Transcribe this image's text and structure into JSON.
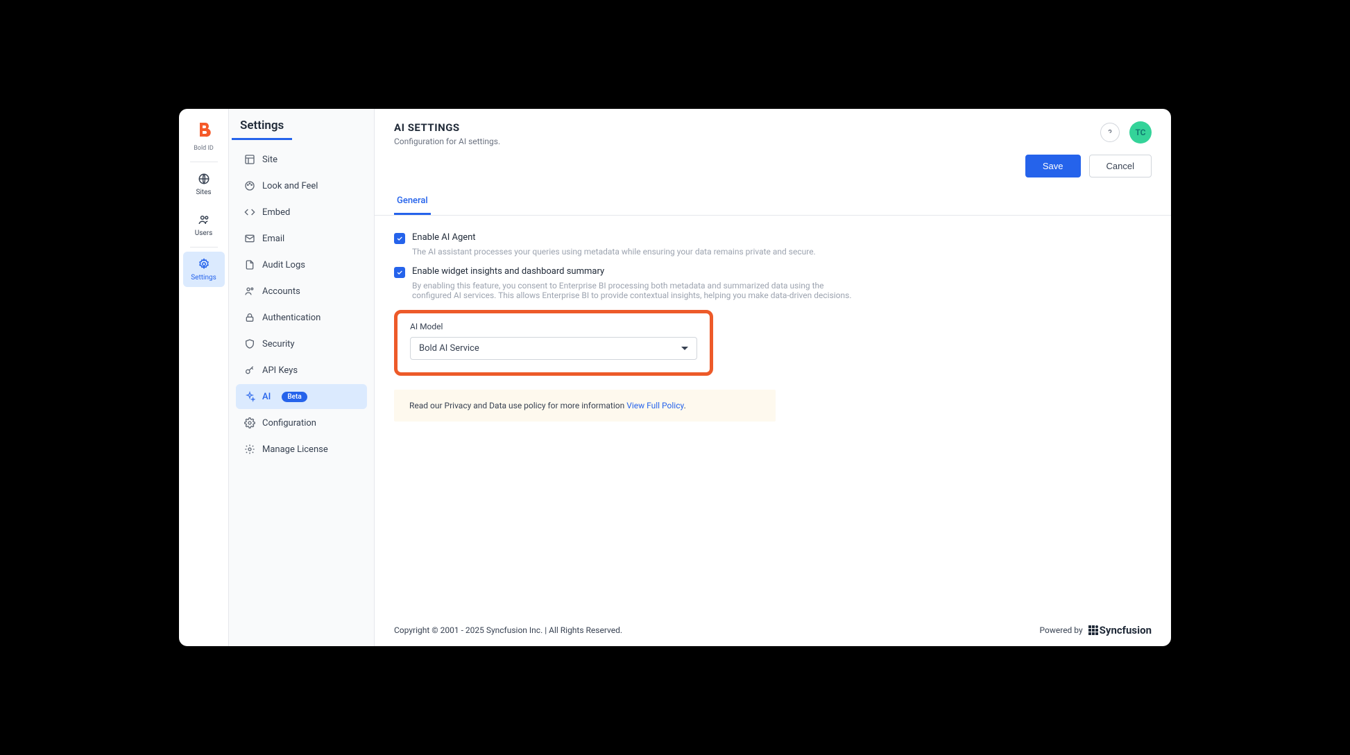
{
  "rail": {
    "logo_text": "Bold ID",
    "items": [
      {
        "id": "sites",
        "label": "Sites"
      },
      {
        "id": "users",
        "label": "Users"
      },
      {
        "id": "settings",
        "label": "Settings"
      }
    ]
  },
  "sidebar": {
    "title": "Settings",
    "items": [
      {
        "id": "site",
        "label": "Site"
      },
      {
        "id": "look",
        "label": "Look and Feel"
      },
      {
        "id": "embed",
        "label": "Embed"
      },
      {
        "id": "email",
        "label": "Email"
      },
      {
        "id": "audit",
        "label": "Audit Logs"
      },
      {
        "id": "accounts",
        "label": "Accounts"
      },
      {
        "id": "auth",
        "label": "Authentication"
      },
      {
        "id": "security",
        "label": "Security"
      },
      {
        "id": "apikeys",
        "label": "API Keys"
      },
      {
        "id": "ai",
        "label": "AI",
        "badge": "Beta"
      },
      {
        "id": "config",
        "label": "Configuration"
      },
      {
        "id": "license",
        "label": "Manage License"
      }
    ]
  },
  "header": {
    "title": "AI SETTINGS",
    "subtitle": "Configuration for AI settings.",
    "avatar": "TC"
  },
  "buttons": {
    "save": "Save",
    "cancel": "Cancel"
  },
  "tabs": {
    "general": "General"
  },
  "form": {
    "cb1_label": "Enable AI Agent",
    "cb1_desc": "The AI assistant processes your queries using metadata while ensuring your data remains private and secure.",
    "cb2_label": "Enable widget insights and dashboard summary",
    "cb2_desc": "By enabling this feature, you consent to Enterprise BI processing both metadata and summarized data using the configured AI services. This allows Enterprise BI to provide contextual insights, helping you make data-driven decisions.",
    "model_label": "AI Model",
    "model_value": "Bold AI Service",
    "policy_prefix": "Read our Privacy and Data use policy for more information ",
    "policy_link": "View Full Policy",
    "policy_suffix": "."
  },
  "footer": {
    "copyright": "Copyright © 2001 - 2025 Syncfusion Inc. | All Rights Reserved.",
    "powered": "Powered by",
    "brand": "Syncfusion"
  }
}
